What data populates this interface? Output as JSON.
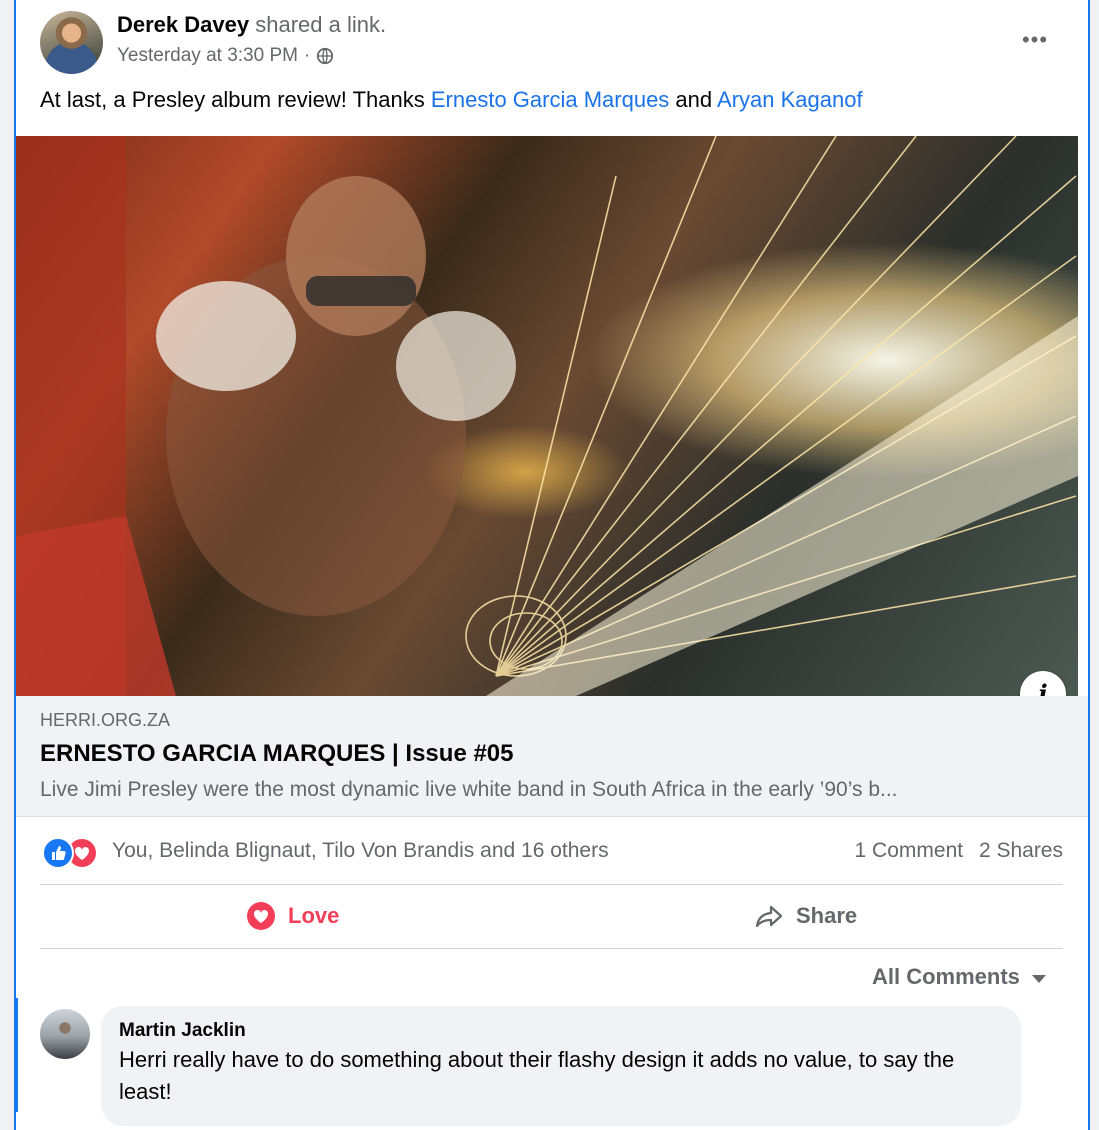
{
  "post": {
    "author": "Derek Davey",
    "action": "shared a link.",
    "timestamp": "Yesterday at 3:30 PM",
    "separator": "·",
    "audience_icon": "globe-icon",
    "more_label": "•••",
    "text_prefix": "At last, a Presley album review! Thanks ",
    "mention_1": "Ernesto Garcia Marques",
    "text_middle": " and ",
    "mention_2": "Aryan Kaganof"
  },
  "link_preview": {
    "domain": "HERRI.ORG.ZA",
    "title": "ERNESTO GARCIA MARQUES | Issue #05",
    "description": "Live Jimi Presley were the most dynamic live white band in South Africa in the early ’90’s b...",
    "info_label": "i"
  },
  "engagement": {
    "reactors": "You, Belinda Blignaut, Tilo Von Brandis and 16 others",
    "comments": "1 Comment",
    "shares": "2 Shares"
  },
  "actions": {
    "love_label": "Love",
    "share_label": "Share"
  },
  "comments": {
    "filter_label": "All Comments",
    "items": [
      {
        "name": "Martin Jacklin",
        "text": "Herri really have to do something about their flashy design it adds no value, to say the least!"
      }
    ]
  },
  "colors": {
    "accent": "#1877f2",
    "love": "#f33e58",
    "link": "#1a73e8",
    "muted": "#65676b"
  }
}
